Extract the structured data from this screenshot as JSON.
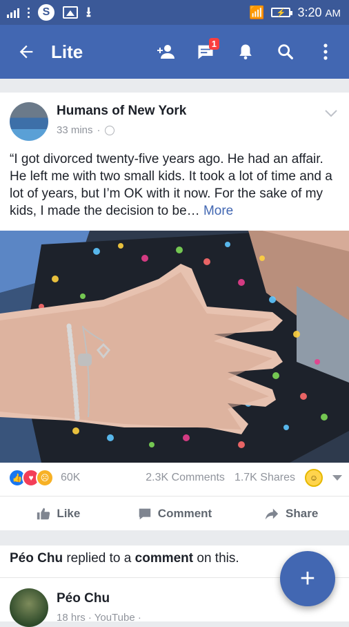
{
  "status_bar": {
    "time": "3:20",
    "ampm": "AM",
    "battery": "",
    "icons": [
      "signal-icon",
      "skype-icon",
      "gallery-icon",
      "download-icon",
      "wifi-icon",
      "battery-icon"
    ]
  },
  "app_bar": {
    "title": "Lite",
    "badge": "1"
  },
  "post": {
    "author": "Humans of New York",
    "time": "33 mins",
    "text": "“I got divorced twenty-five years ago. He had an affair. He left me with two small kids. It took a lot of time and a lot of years, but I’m OK with it now. For the sake of my kids, I made the decision to be… ",
    "more": "More",
    "reactions_count": "60K",
    "comments": "2.3K Comments",
    "shares": "1.7K Shares",
    "actions": {
      "like": "Like",
      "comment": "Comment",
      "share": "Share"
    }
  },
  "notification": {
    "actor": "Péo Chu",
    "middle": " replied to a ",
    "object": "comment",
    "tail": " on this.",
    "name": "Péo Chu",
    "meta": "18 hrs · YouTube ·"
  },
  "colors": {
    "brand": "#4267b2",
    "statusbar": "#3b5998",
    "link": "#4267b2",
    "like_blue": "#1877f2",
    "love_red": "#f33e58",
    "sad_yellow": "#f7b125"
  }
}
